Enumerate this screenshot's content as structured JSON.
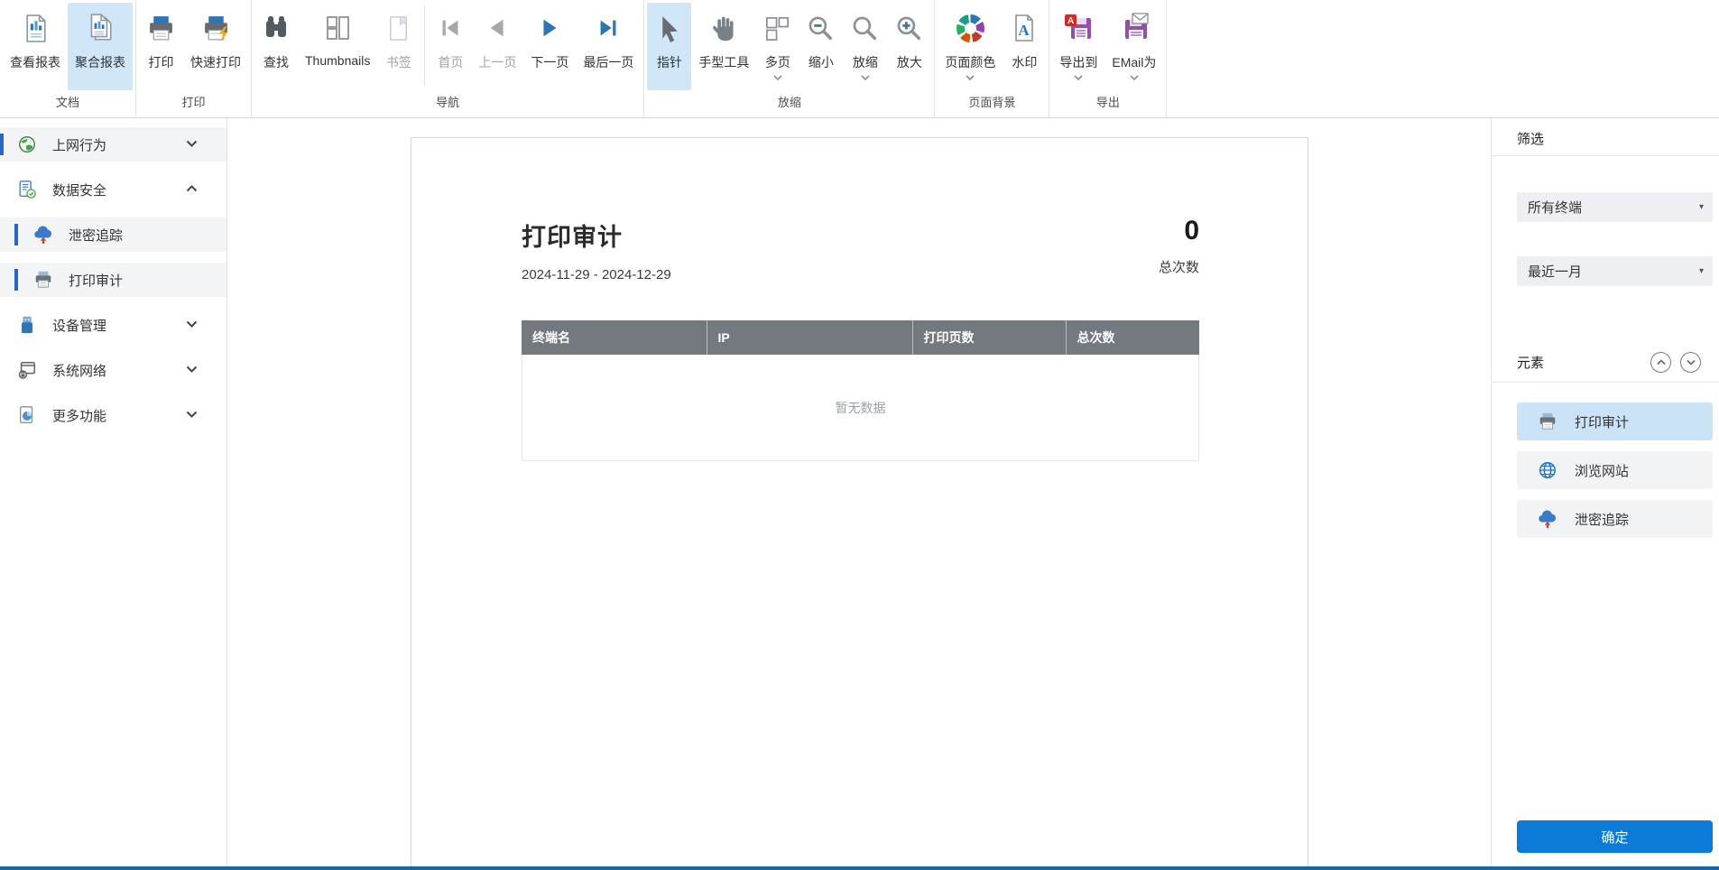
{
  "colors": {
    "accent_blue": "#0c7bd8",
    "selection_highlight": "#cfe7f9",
    "table_header_gray": "#74787f",
    "status_bar_blue": "#1667a8",
    "indicator_bar_blue": "#2467c4",
    "element_selected_blue": "#cbe3f7"
  },
  "ribbon": {
    "groups": [
      {
        "label": "文档",
        "buttons": [
          {
            "label": "查看报表",
            "icon": "report-document-icon"
          },
          {
            "label": "聚合报表",
            "icon": "aggregate-report-icon",
            "selected": true
          }
        ]
      },
      {
        "label": "打印",
        "buttons": [
          {
            "label": "打印",
            "icon": "printer-icon"
          },
          {
            "label": "快速打印",
            "icon": "quick-print-icon"
          }
        ]
      },
      {
        "label": "导航",
        "buttons": [
          {
            "label": "查找",
            "icon": "binoculars-icon"
          },
          {
            "label": "Thumbnails",
            "icon": "thumbnails-icon"
          },
          {
            "label": "书签",
            "icon": "bookmark-icon",
            "disabled": true
          },
          {
            "label": "首页",
            "icon": "first-page-icon",
            "disabled": true
          },
          {
            "label": "上一页",
            "icon": "previous-page-icon",
            "disabled": true
          },
          {
            "label": "下一页",
            "icon": "next-page-icon"
          },
          {
            "label": "最后一页",
            "icon": "last-page-icon"
          }
        ]
      },
      {
        "label": "放缩",
        "buttons": [
          {
            "label": "指针",
            "icon": "pointer-cursor-icon",
            "selected": true
          },
          {
            "label": "手型工具",
            "icon": "hand-tool-icon"
          },
          {
            "label": "多页",
            "icon": "multi-page-icon",
            "dropdown": true
          },
          {
            "label": "缩小",
            "icon": "zoom-out-icon"
          },
          {
            "label": "放缩",
            "icon": "zoom-icon",
            "dropdown": true
          },
          {
            "label": "放大",
            "icon": "zoom-in-icon"
          }
        ]
      },
      {
        "label": "页面背景",
        "buttons": [
          {
            "label": "页面颜色",
            "icon": "page-color-icon",
            "dropdown": true
          },
          {
            "label": "水印",
            "icon": "watermark-icon"
          }
        ]
      },
      {
        "label": "导出",
        "buttons": [
          {
            "label": "导出到",
            "icon": "export-to-icon",
            "dropdown": true
          },
          {
            "label": "EMail为",
            "icon": "email-as-icon",
            "dropdown": true
          }
        ]
      }
    ]
  },
  "sidebar": {
    "items": [
      {
        "label": "上网行为",
        "icon": "globe-icon",
        "chevron": "down",
        "shaded": true,
        "indicator": true
      },
      {
        "label": "数据安全",
        "icon": "document-shield-icon",
        "chevron": "up",
        "expanded": true
      },
      {
        "label": "泄密追踪",
        "icon": "cloud-upload-icon",
        "child": true,
        "shaded": true,
        "indicator": true
      },
      {
        "label": "打印审计",
        "icon": "printer-icon",
        "child": true,
        "shaded": true,
        "indicator": true
      },
      {
        "label": "设备管理",
        "icon": "usb-drive-icon",
        "chevron": "down"
      },
      {
        "label": "系统网络",
        "icon": "network-lock-icon",
        "chevron": "down"
      },
      {
        "label": "更多功能",
        "icon": "document-pie-icon",
        "chevron": "down"
      }
    ]
  },
  "report": {
    "title": "打印审计",
    "date_range": "2024-11-29 - 2024-12-29",
    "total_value": "0",
    "total_label": "总次数",
    "table": {
      "headers": [
        "终端名",
        "IP",
        "打印页数",
        "总次数"
      ],
      "rows": [],
      "empty_text": "暂无数据"
    }
  },
  "filter_panel": {
    "title": "筛选",
    "terminal_filter": {
      "value": "所有终端"
    },
    "time_filter": {
      "value": "最近一月"
    },
    "elements_title": "元素",
    "elements": [
      {
        "label": "打印审计",
        "icon": "printer-icon",
        "selected": true
      },
      {
        "label": "浏览网站",
        "icon": "globe-icon"
      },
      {
        "label": "泄密追踪",
        "icon": "cloud-upload-icon"
      }
    ],
    "ok_label": "确定"
  }
}
